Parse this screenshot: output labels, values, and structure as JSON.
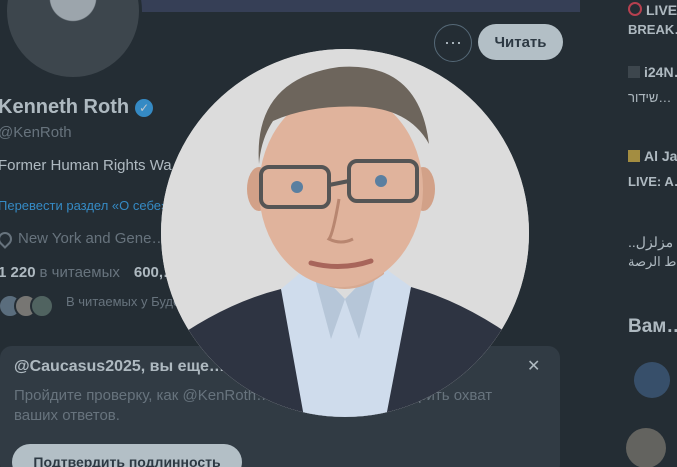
{
  "profile": {
    "name": "Kenneth Roth",
    "handle": "@KenRoth",
    "bio": "Former Human Rights Wa… professor, Princeton SPIA …",
    "translate_label": "Перевести раздел «О себе»",
    "location": "New York and Gene…",
    "following_count": "1 220",
    "following_label": "в читаемых",
    "followers_count": "600,…",
    "followed_by_text": "В читаемых у Буде… еще 44 пользовате…",
    "more_icon": "⋯",
    "follow_button": "Читать"
  },
  "verify_prompt": {
    "title": "@Caucasus2025, вы еще…",
    "text": "Пройдите проверку, как @KenRoth… …не других и расширить охват ваших ответов.",
    "button": "Подтвердить подлинность",
    "close_icon": "✕"
  },
  "sidebar": {
    "trends": [
      {
        "title": "LIVE",
        "subtitle": "BREAK…",
        "icon": "live-dot"
      },
      {
        "title": "i24N…",
        "subtitle": "שידור…",
        "icon": "news-logo"
      },
      {
        "title": "Al Ja…",
        "subtitle": "LIVE: A…",
        "icon": "news-logo"
      },
      {
        "title": "..مزلزل",
        "subtitle": "ط الرصة…",
        "icon": ""
      }
    ],
    "who_to_follow_title": "Вам…"
  },
  "modal": {
    "photo_alt": "Kenneth Roth"
  },
  "colors": {
    "accent": "#1d9bf0",
    "background": "#000000",
    "overlay": "rgba(91,112,131,0.4)"
  }
}
